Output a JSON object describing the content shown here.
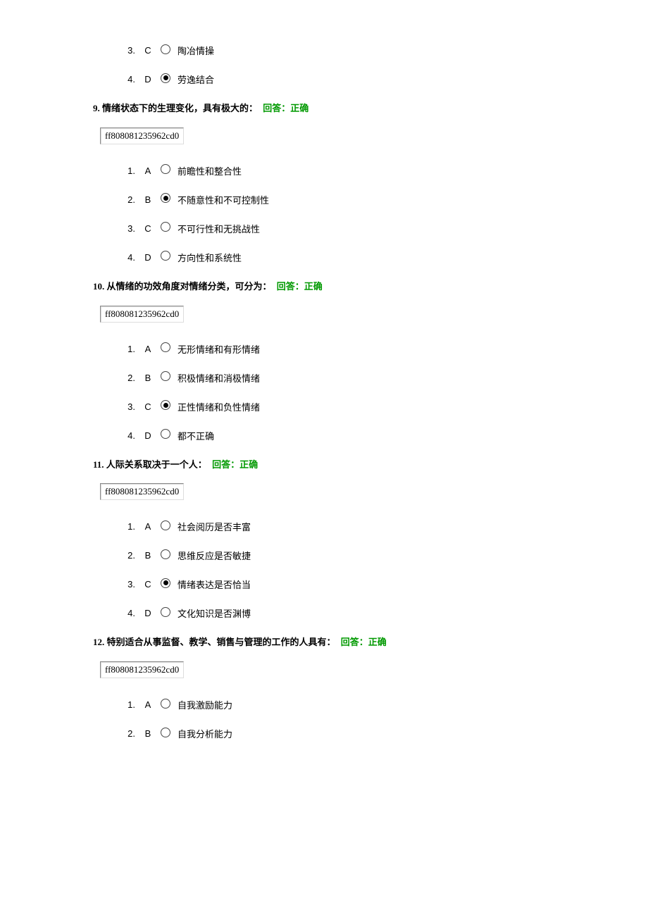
{
  "id_code": "ff808081235962cd0",
  "feedback_prefix": "回答：",
  "feedback_value": "正确",
  "partial_options": [
    {
      "index": "3.",
      "letter": "C",
      "checked": false,
      "text": "陶冶情操"
    },
    {
      "index": "4.",
      "letter": "D",
      "checked": true,
      "text": "劳逸结合"
    }
  ],
  "questions": [
    {
      "number": "9.",
      "stem": "情绪状态下的生理变化，具有极大的：",
      "show_id": true,
      "options": [
        {
          "index": "1.",
          "letter": "A",
          "checked": false,
          "text": "前瞻性和整合性"
        },
        {
          "index": "2.",
          "letter": "B",
          "checked": true,
          "text": "不随意性和不可控制性"
        },
        {
          "index": "3.",
          "letter": "C",
          "checked": false,
          "text": "不可行性和无挑战性"
        },
        {
          "index": "4.",
          "letter": "D",
          "checked": false,
          "text": "方向性和系统性"
        }
      ]
    },
    {
      "number": "10.",
      "stem": "从情绪的功效角度对情绪分类，可分为：",
      "show_id": true,
      "options": [
        {
          "index": "1.",
          "letter": "A",
          "checked": false,
          "text": "无形情绪和有形情绪"
        },
        {
          "index": "2.",
          "letter": "B",
          "checked": false,
          "text": "积极情绪和消极情绪"
        },
        {
          "index": "3.",
          "letter": "C",
          "checked": true,
          "text": "正性情绪和负性情绪"
        },
        {
          "index": "4.",
          "letter": "D",
          "checked": false,
          "text": "都不正确"
        }
      ]
    },
    {
      "number": "11.",
      "stem": "人际关系取决于一个人：",
      "show_id": true,
      "options": [
        {
          "index": "1.",
          "letter": "A",
          "checked": false,
          "text": "社会阅历是否丰富"
        },
        {
          "index": "2.",
          "letter": "B",
          "checked": false,
          "text": "思维反应是否敏捷"
        },
        {
          "index": "3.",
          "letter": "C",
          "checked": true,
          "text": "情绪表达是否恰当"
        },
        {
          "index": "4.",
          "letter": "D",
          "checked": false,
          "text": "文化知识是否渊博"
        }
      ]
    },
    {
      "number": "12.",
      "stem": "特别适合从事监督、教学、销售与管理的工作的人具有：",
      "show_id": true,
      "options": [
        {
          "index": "1.",
          "letter": "A",
          "checked": false,
          "text": "自我激励能力"
        },
        {
          "index": "2.",
          "letter": "B",
          "checked": false,
          "text": "自我分析能力"
        }
      ]
    }
  ]
}
